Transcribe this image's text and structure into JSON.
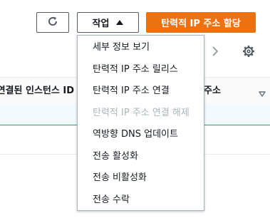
{
  "toolbar": {
    "refresh_icon": "refresh-icon",
    "actions_label": "작업",
    "actions_caret_icon": "caret-up-icon",
    "allocate_label": "탄력적 IP 주소 할당",
    "accent_color": "#ec7211"
  },
  "table": {
    "next_page_icon": "chevron-right-icon",
    "settings_icon": "gear-icon",
    "columns": [
      {
        "label": "연결된 인스턴스 ID"
      },
      {
        "label": "주소"
      }
    ],
    "sort_icon": "sort-down-icon"
  },
  "menu": {
    "items": [
      {
        "label": "세부 정보 보기",
        "disabled": false
      },
      {
        "label": "탄력적 IP 주소 릴리스",
        "disabled": false
      },
      {
        "label": "탄력적 IP 주소 연결",
        "disabled": false
      },
      {
        "label": "탄력적 IP 주소 연결 해제",
        "disabled": true
      },
      {
        "label": "역방향 DNS 업데이트",
        "disabled": false
      },
      {
        "label": "전송 활성화",
        "disabled": false
      },
      {
        "label": "전송 비활성화",
        "disabled": false
      },
      {
        "label": "전송 수락",
        "disabled": false
      }
    ]
  }
}
